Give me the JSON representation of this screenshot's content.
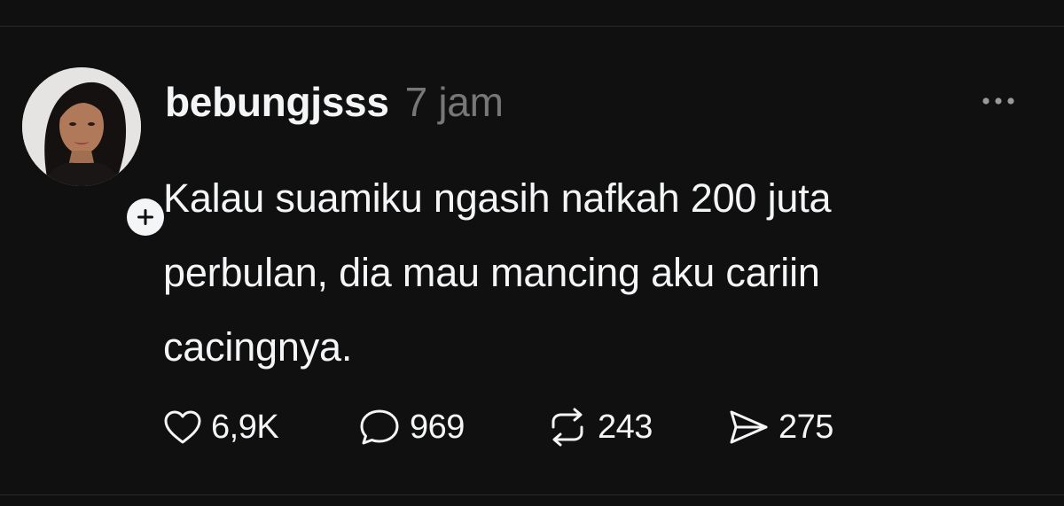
{
  "post": {
    "username": "bebungjsss",
    "time": "7 jam",
    "text_lines": [
      "Kalau suamiku ngasih nafkah 200 juta",
      "perbulan, dia mau mancing aku cariin",
      "cacingnya."
    ],
    "stats": {
      "likes": "6,9K",
      "replies": "969",
      "reposts": "243",
      "shares": "275"
    }
  },
  "icons": {
    "follow": "plus-icon",
    "more": "more-horizontal-icon",
    "like": "heart-icon",
    "reply": "comment-bubble-icon",
    "repost": "repost-arrows-icon",
    "share": "send-icon"
  },
  "colors": {
    "background": "#101010",
    "text_primary": "#f3f5f7",
    "text_secondary": "#777777",
    "divider": "#2a2a2a"
  }
}
